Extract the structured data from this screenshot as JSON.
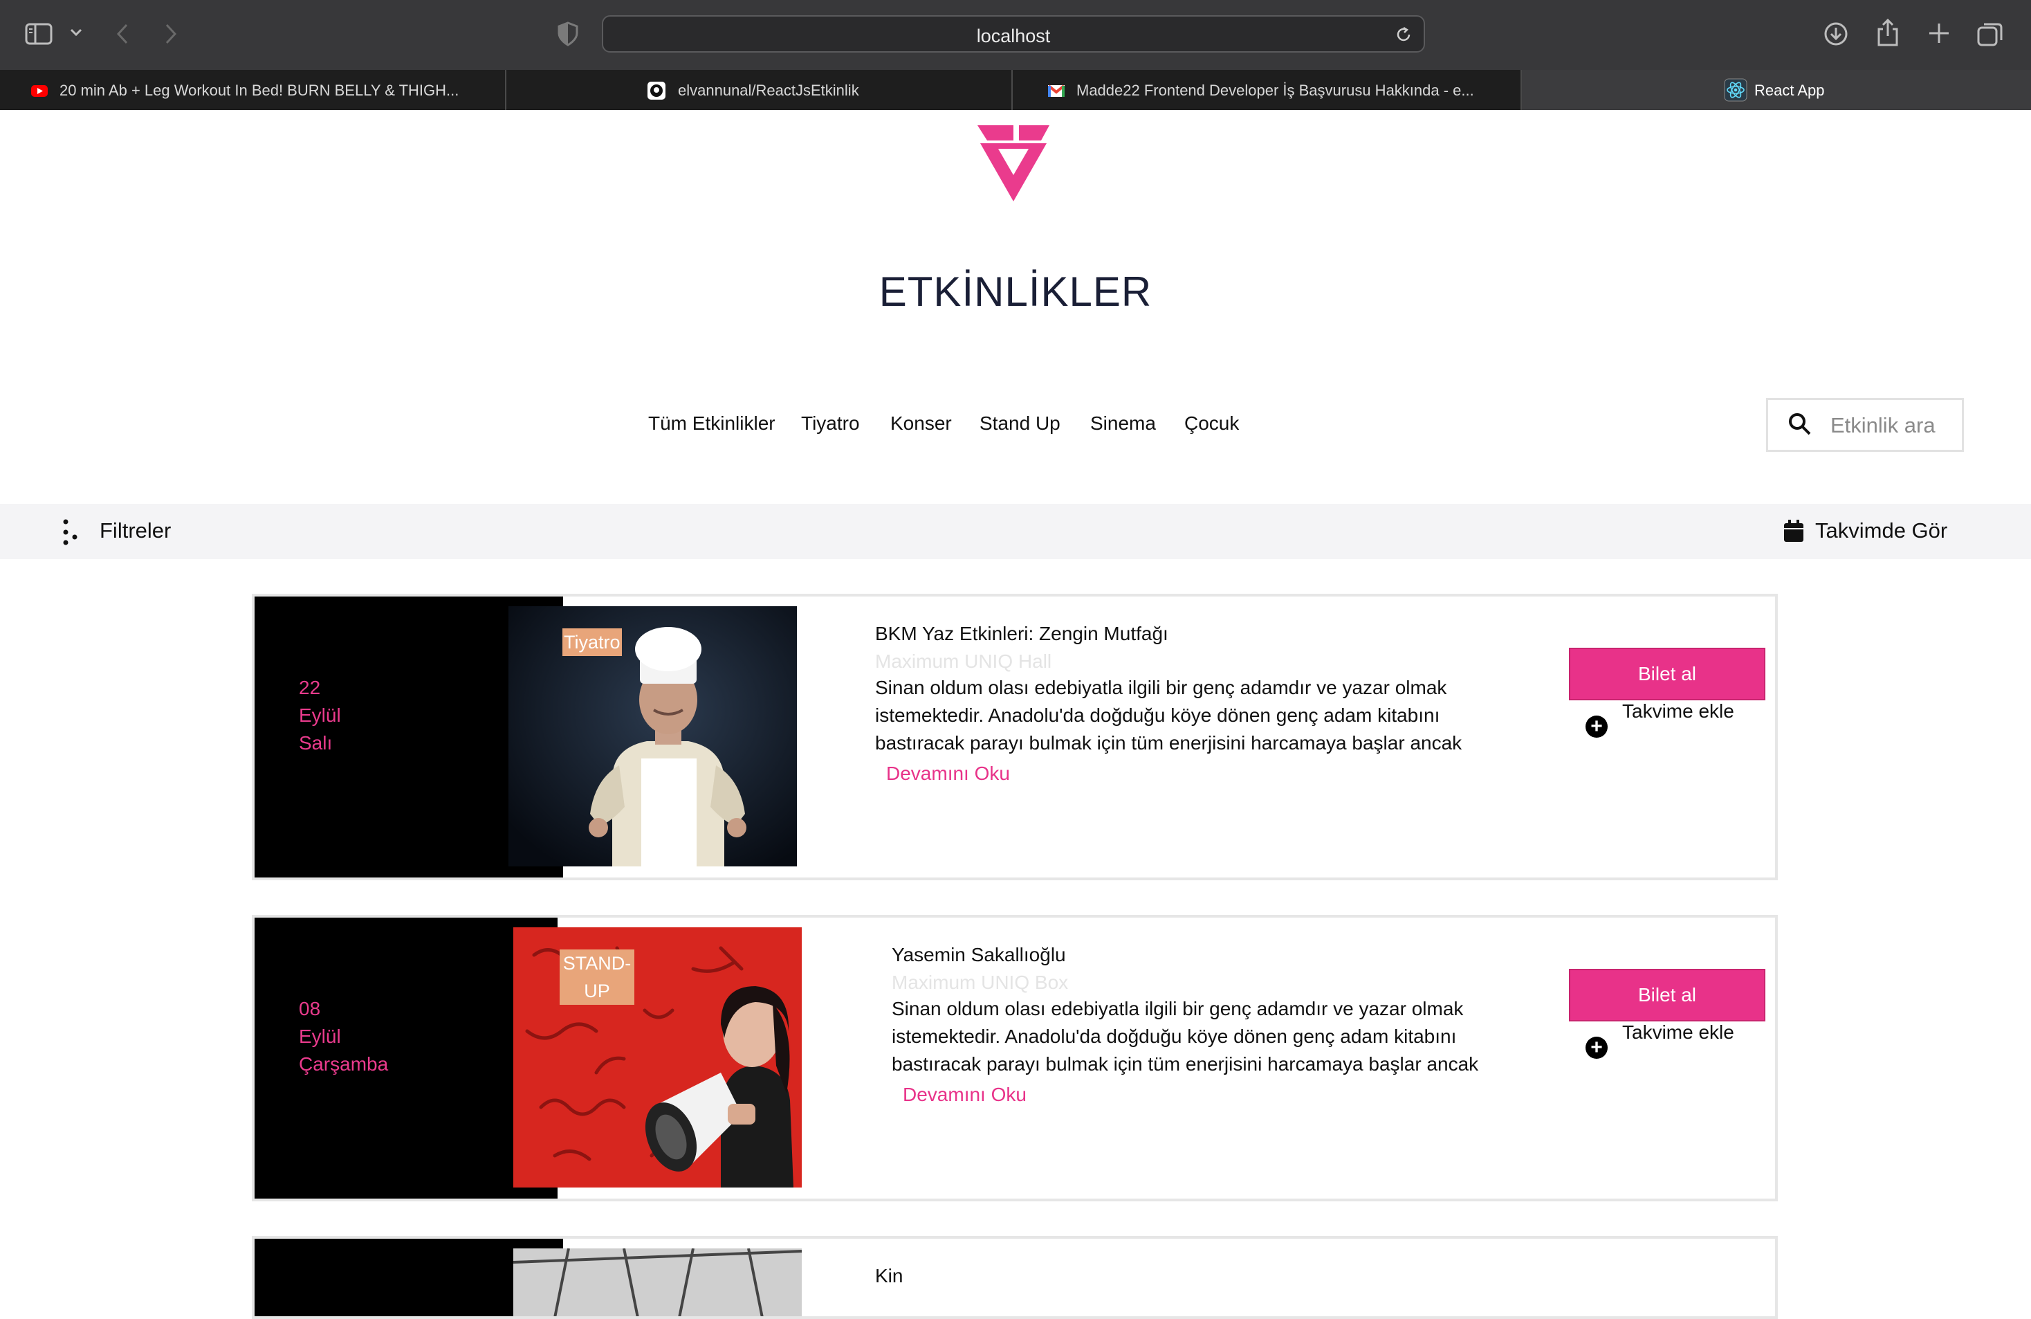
{
  "browser": {
    "url": "localhost",
    "tabs": [
      {
        "title": "20 min Ab + Leg Workout In Bed! BURN BELLY & THIGH...",
        "favicon": "youtube-icon"
      },
      {
        "title": "elvannunal/ReactJsEtkinlik",
        "favicon": "github-icon"
      },
      {
        "title": "Madde22 Frontend Developer İş Başvurusu Hakkında - e...",
        "favicon": "gmail-icon"
      },
      {
        "title": "React App",
        "favicon": "react-icon",
        "active": true
      }
    ]
  },
  "header": {
    "title": "ETKİNLİKLER",
    "brand_color": "#ea3b8d"
  },
  "nav": {
    "items": [
      "Tüm Etkinlikler",
      "Tiyatro",
      "Konser",
      "Stand Up",
      "Sinema",
      "Çocuk"
    ]
  },
  "search": {
    "placeholder": "Etkinlik ara",
    "value": ""
  },
  "filter_bar": {
    "filters_label": "Filtreler",
    "calendar_label": "Takvimde Gör"
  },
  "events": [
    {
      "day": "22",
      "month": "Eylül",
      "weekday": "Salı",
      "category": "Tiyatro",
      "title": "BKM Yaz Etkinleri: Zengin Mutfağı",
      "venue": "Maximum UNIQ Hall",
      "description": "Sinan oldum olası edebiyatla ilgili bir genç adamdır ve yazar olmak istemektedir. Anadolu'da doğduğu köye dönen genç adam kitabını bastıracak parayı bulmak için tüm enerjisini harcamaya başlar ancak",
      "read_more": "Devamını Oku",
      "buy_label": "Bilet al",
      "calendar_label": "Takvime ekle"
    },
    {
      "day": "08",
      "month": "Eylül",
      "weekday": "Çarşamba",
      "category": "STAND-UP",
      "title": "Yasemin Sakallıoğlu",
      "venue": "Maximum UNIQ Box",
      "description": "Sinan oldum olası edebiyatla ilgili bir genç adamdır ve yazar olmak istemektedir. Anadolu'da doğduğu köye dönen genç adam kitabını bastıracak parayı bulmak için tüm enerjisini harcamaya başlar ancak",
      "read_more": "Devamını Oku",
      "buy_label": "Bilet al",
      "calendar_label": "Takvime ekle"
    },
    {
      "title": "Kin"
    }
  ],
  "colors": {
    "accent": "#e83289",
    "category_badge": "#e8a57a",
    "date_panel": "#000000",
    "filter_bar": "#f4f4f6"
  }
}
